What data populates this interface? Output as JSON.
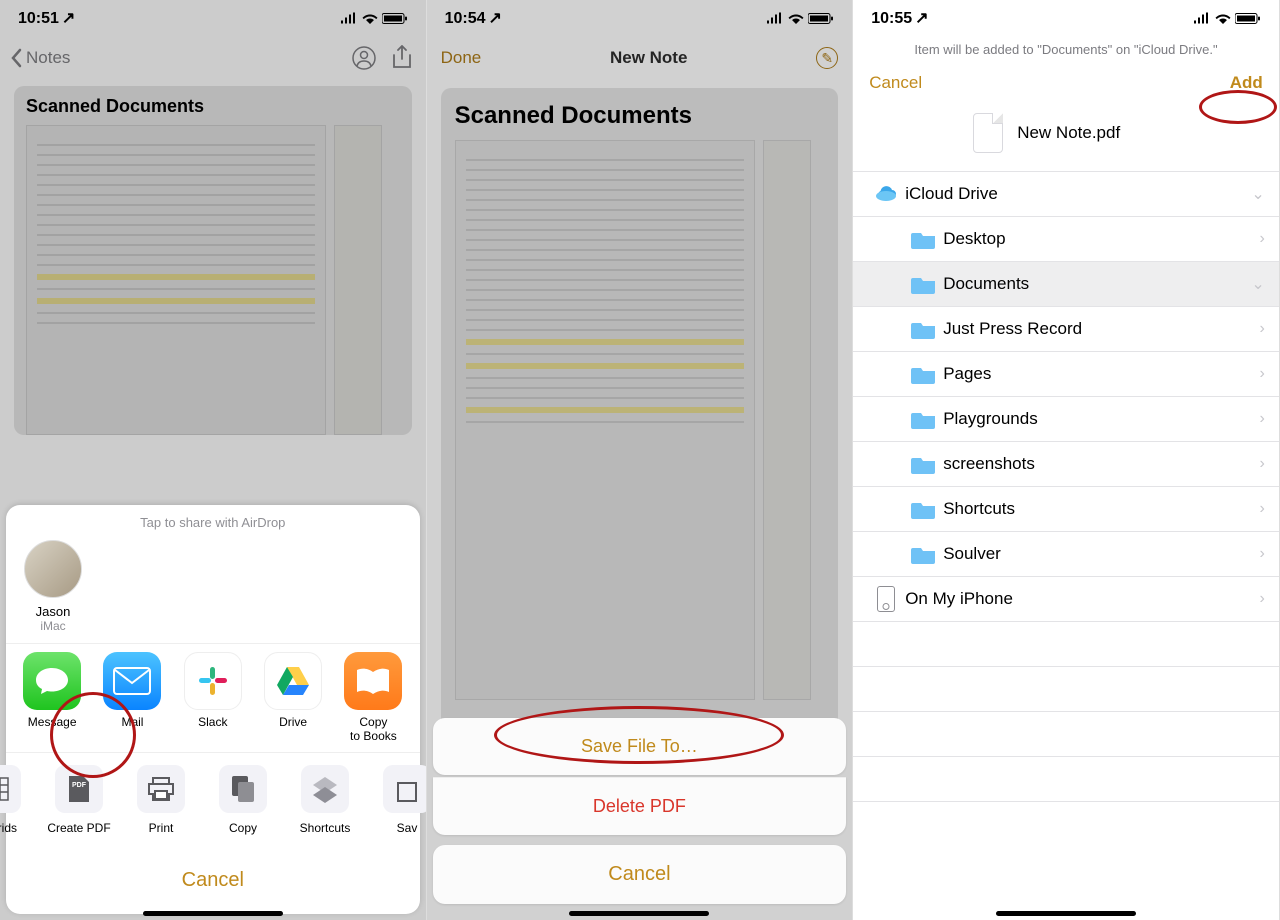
{
  "panel1": {
    "time": "10:51",
    "back": "Notes",
    "card_title": "Scanned Documents",
    "sheet_header": "Tap to share with AirDrop",
    "airdrop_name": "Jason",
    "airdrop_sub": "iMac",
    "apps": [
      "Message",
      "Mail",
      "Slack",
      "Drive",
      "Copy\nto Books"
    ],
    "actions": [
      "& Grids",
      "Create PDF",
      "Print",
      "Copy",
      "Shortcuts",
      "Sav"
    ],
    "cancel": "Cancel"
  },
  "panel2": {
    "time": "10:54",
    "done": "Done",
    "title": "New Note",
    "card_title": "Scanned Documents",
    "save": "Save File To…",
    "delete": "Delete PDF",
    "cancel": "Cancel"
  },
  "panel3": {
    "time": "10:55",
    "banner": "Item will be added to \"Documents\" on \"iCloud Drive.\"",
    "cancel": "Cancel",
    "add": "Add",
    "filename": "New Note.pdf",
    "icloud": "iCloud Drive",
    "folders": [
      "Desktop",
      "Documents",
      "Just Press Record",
      "Pages",
      "Playgrounds",
      "screenshots",
      "Shortcuts",
      "Soulver"
    ],
    "oniphone": "On My iPhone"
  }
}
